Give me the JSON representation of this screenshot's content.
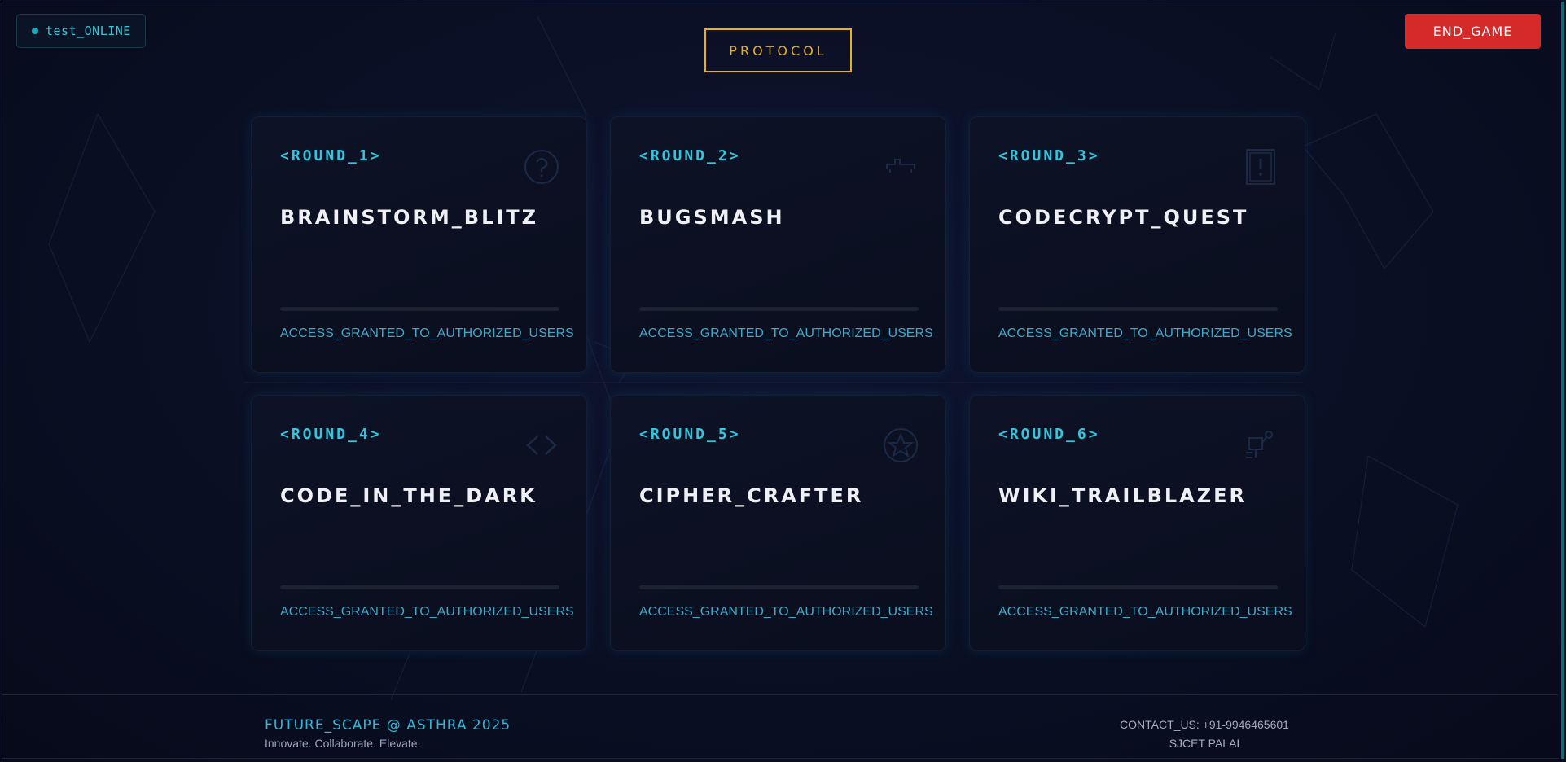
{
  "header": {
    "status_text": "test_ONLINE",
    "protocol_label": "PROTOCOL",
    "end_game_label": "END_GAME"
  },
  "rounds": [
    {
      "label": "<ROUND_1>",
      "title": "BRAINSTORM_BLITZ",
      "access": "ACCESS_GRANTED_TO_AUTHORIZED_USERS",
      "icon": "question-icon"
    },
    {
      "label": "<ROUND_2>",
      "title": "BUGSMASH",
      "access": "ACCESS_GRANTED_TO_AUTHORIZED_USERS",
      "icon": "bug-icon"
    },
    {
      "label": "<ROUND_3>",
      "title": "CODECRYPT_QUEST",
      "access": "ACCESS_GRANTED_TO_AUTHORIZED_USERS",
      "icon": "alert-book-icon"
    },
    {
      "label": "<ROUND_4>",
      "title": "CODE_IN_THE_DARK",
      "access": "ACCESS_GRANTED_TO_AUTHORIZED_USERS",
      "icon": "code-brackets-icon"
    },
    {
      "label": "<ROUND_5>",
      "title": "CIPHER_CRAFTER",
      "access": "ACCESS_GRANTED_TO_AUTHORIZED_USERS",
      "icon": "star-badge-icon"
    },
    {
      "label": "<ROUND_6>",
      "title": "WIKI_TRAILBLAZER",
      "access": "ACCESS_GRANTED_TO_AUTHORIZED_USERS",
      "icon": "network-icon"
    }
  ],
  "footer": {
    "brand": "FUTURE_SCAPE @ ASTHRA 2025",
    "tagline": "Innovate. Collaborate. Elevate.",
    "contact": "CONTACT_US: +91-9946465601",
    "org": "SJCET PALAI"
  },
  "colors": {
    "accent_cyan": "#34c4dc",
    "protocol_gold": "#e6b020",
    "danger_red": "#d42a2a",
    "background": "#0a0f24"
  }
}
